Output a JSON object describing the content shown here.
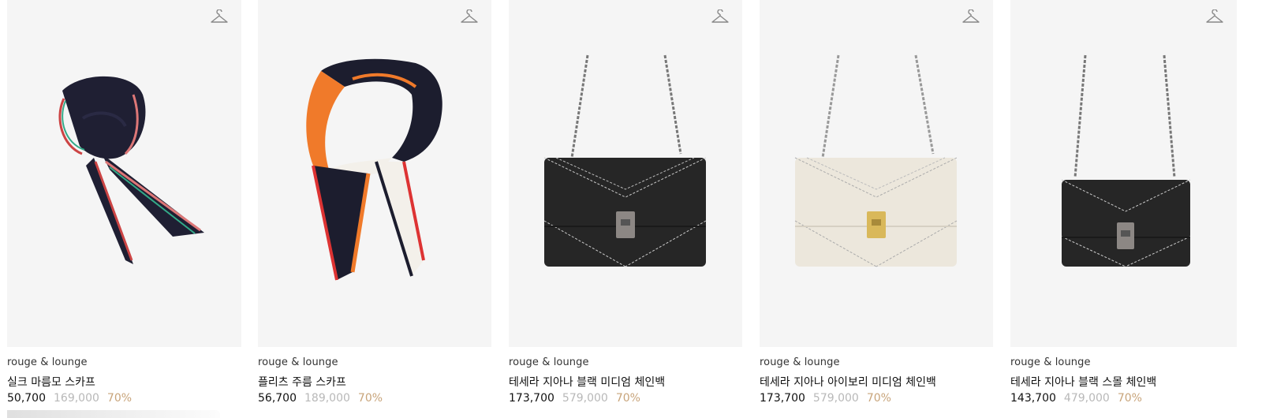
{
  "products": [
    {
      "brand": "rouge & lounge",
      "name": "실크 마름모 스카프",
      "price": "50,700",
      "original_price": "169,000",
      "discount": "70%",
      "image": "scarf-navy-stripes"
    },
    {
      "brand": "rouge & lounge",
      "name": "플리츠 주름 스카프",
      "price": "56,700",
      "original_price": "189,000",
      "discount": "70%",
      "image": "scarf-pleated-orange-navy"
    },
    {
      "brand": "rouge & lounge",
      "name": "테세라 지아나 블랙 미디엄 체인백",
      "price": "173,700",
      "original_price": "579,000",
      "discount": "70%",
      "image": "bag-black-medium"
    },
    {
      "brand": "rouge & lounge",
      "name": "테세라 지아나 아이보리 미디엄 체인백",
      "price": "173,700",
      "original_price": "579,000",
      "discount": "70%",
      "image": "bag-ivory-medium"
    },
    {
      "brand": "rouge & lounge",
      "name": "테세라 지아나 블랙 스몰 체인백",
      "price": "143,700",
      "original_price": "479,000",
      "discount": "70%",
      "image": "bag-black-small"
    }
  ],
  "colors": {
    "thumb_bg": "#f5f5f5",
    "discount": "#c8a47a",
    "original_price": "#b8b8b8"
  }
}
